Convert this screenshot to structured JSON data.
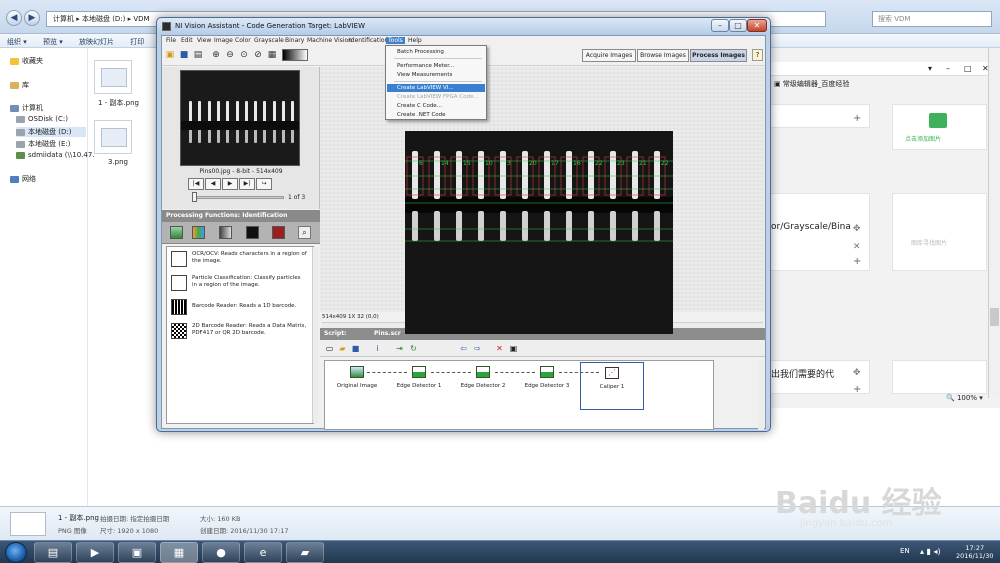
{
  "explorer": {
    "path": [
      "计算机",
      "本地磁盘 (D:)",
      "VDM"
    ],
    "search_placeholder": "搜索 VDM",
    "toolbar": [
      "组织 ▾",
      "预览 ▾",
      "放映幻灯片",
      "打印"
    ],
    "sidebar": {
      "favorites": "收藏夹",
      "libraries": "库",
      "computer": "计算机",
      "drives": [
        "OSDisk (C:)",
        "本地磁盘 (D:)",
        "本地磁盘 (E:)",
        "sdmiidata (\\\\10.47."
      ],
      "network": "网络"
    },
    "files": [
      {
        "name": "1 - 副本.png"
      },
      {
        "name": "3.png"
      }
    ],
    "details": {
      "file_name": "1 - 副本.png",
      "type": "PNG 图像",
      "date_label": "拍摄日期: 指定拍摄日期",
      "dimensions": "尺寸: 1920 x 1080",
      "size": "大小: 160 KB",
      "created": "创建日期: 2016/11/30 17:17"
    }
  },
  "browser": {
    "tab": "常级编辑器_百度经验",
    "side_text_1": "or/Grayscale/Bina",
    "side_text_2": "出我们需要的代",
    "add_image": "点击添加图片",
    "add_image_2": "图库寻找图片",
    "zoom": "100%"
  },
  "va": {
    "title": "NI Vision Assistant - Code Generation Target: LabVIEW",
    "menu": [
      "File",
      "Edit",
      "View",
      "Image",
      "Color",
      "Grayscale",
      "Binary",
      "Machine Vision",
      "Identification",
      "Tools",
      "Help"
    ],
    "active_menu": "Tools",
    "mode_tabs": [
      "Acquire Images",
      "Browse Images",
      "Process Images"
    ],
    "active_mode": "Process Images",
    "help": "?",
    "thumb_caption": "Pins00.jpg - 8-bit - 514x409",
    "page_count": "1  of  3",
    "processing_header": "Processing Functions: Identification",
    "functions": [
      {
        "name": "OCR/OCV:",
        "desc": "OCR/OCV:  Reads characters in a region of the image."
      },
      {
        "name": "Particle Classification",
        "desc": "Particle Classification:  Classify particles in a region of the image."
      },
      {
        "name": "Barcode Reader",
        "desc": "Barcode Reader:  Reads a 1D barcode."
      },
      {
        "name": "2D Barcode Reader",
        "desc": "2D Barcode Reader:  Reads a Data Matrix, PDF417 or QR 2D barcode."
      }
    ],
    "status": "514x409  1X 32     (0,0)",
    "script_label": "Script:",
    "script_name": "Pins.scr",
    "steps": [
      "Original Image",
      "Edge Detector 1",
      "Edge Detector 2",
      "Edge Detector 3",
      "Caliper 1"
    ],
    "tools_menu": {
      "items": [
        {
          "label": "Batch Processing",
          "state": "normal"
        },
        {
          "label": "Performance Meter...",
          "state": "normal"
        },
        {
          "label": "View Measurements",
          "state": "normal"
        },
        {
          "label": "Create LabVIEW VI...",
          "state": "highlight"
        },
        {
          "label": "Create LabVIEW FPGA Code...",
          "state": "disabled"
        },
        {
          "label": "Create C Code...",
          "state": "normal"
        },
        {
          "label": "Create .NET Code",
          "state": "normal"
        }
      ]
    },
    "pin_labels": [
      "6",
      "14",
      "15",
      "10",
      "3",
      "20",
      "17",
      "16",
      "22",
      "23",
      "21",
      "22"
    ]
  },
  "taskbar": {
    "lang": "EN",
    "time": "17:27",
    "date": "2016/11/30"
  },
  "watermark": {
    "text": "Baidu 经验",
    "url": "jingyan.baidu.com"
  },
  "colors": {
    "accent": "#3a7fd0",
    "edge_green": "#34c94a",
    "edge_red": "#d43b3b"
  }
}
